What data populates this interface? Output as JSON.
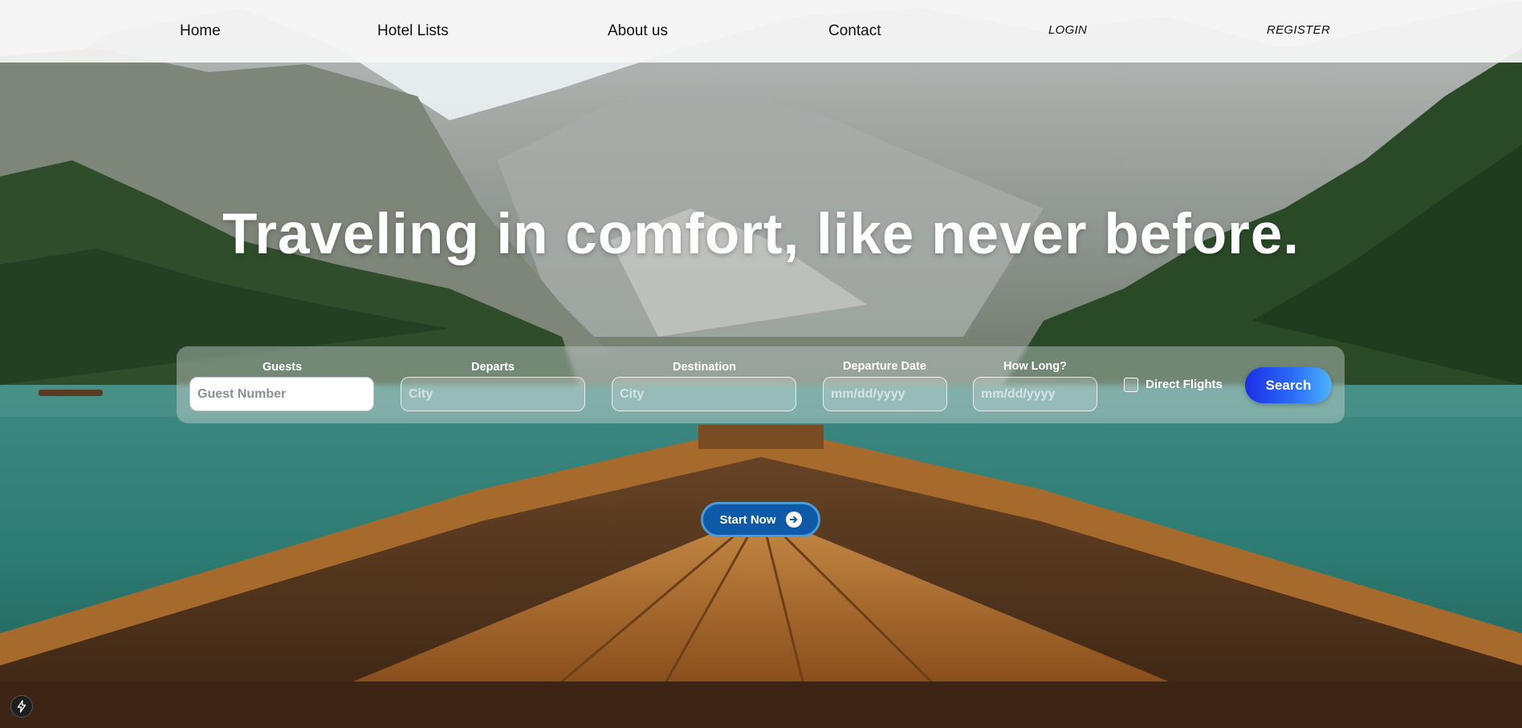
{
  "nav": {
    "home": "Home",
    "hotel_lists": "Hotel Lists",
    "about_us": "About us",
    "contact": "Contact",
    "login": "LOGIN",
    "register": "REGISTER"
  },
  "hero": {
    "headline": "Traveling in comfort, like never before."
  },
  "search": {
    "guests_label": "Guests",
    "guests_placeholder": "Guest Number",
    "departs_label": "Departs",
    "departs_placeholder": "City",
    "destination_label": "Destination",
    "destination_placeholder": "City",
    "departure_date_label": "Departure Date",
    "departure_date_placeholder": "mm/dd/yyyy",
    "how_long_label": "How Long?",
    "how_long_placeholder": "mm/dd/yyyy",
    "direct_flights_label": "Direct Flights",
    "search_label": "Search"
  },
  "cta": {
    "start_now": "Start Now"
  },
  "icons": {
    "start_arrow": "arrow-right-circle-icon",
    "badge": "lightning-bolt-icon"
  },
  "colors": {
    "nav_bg": "#f5f5f5",
    "search_button_start": "#1b2fe8",
    "search_button_end": "#4cb4ff",
    "start_button": "#0f5aa8"
  }
}
